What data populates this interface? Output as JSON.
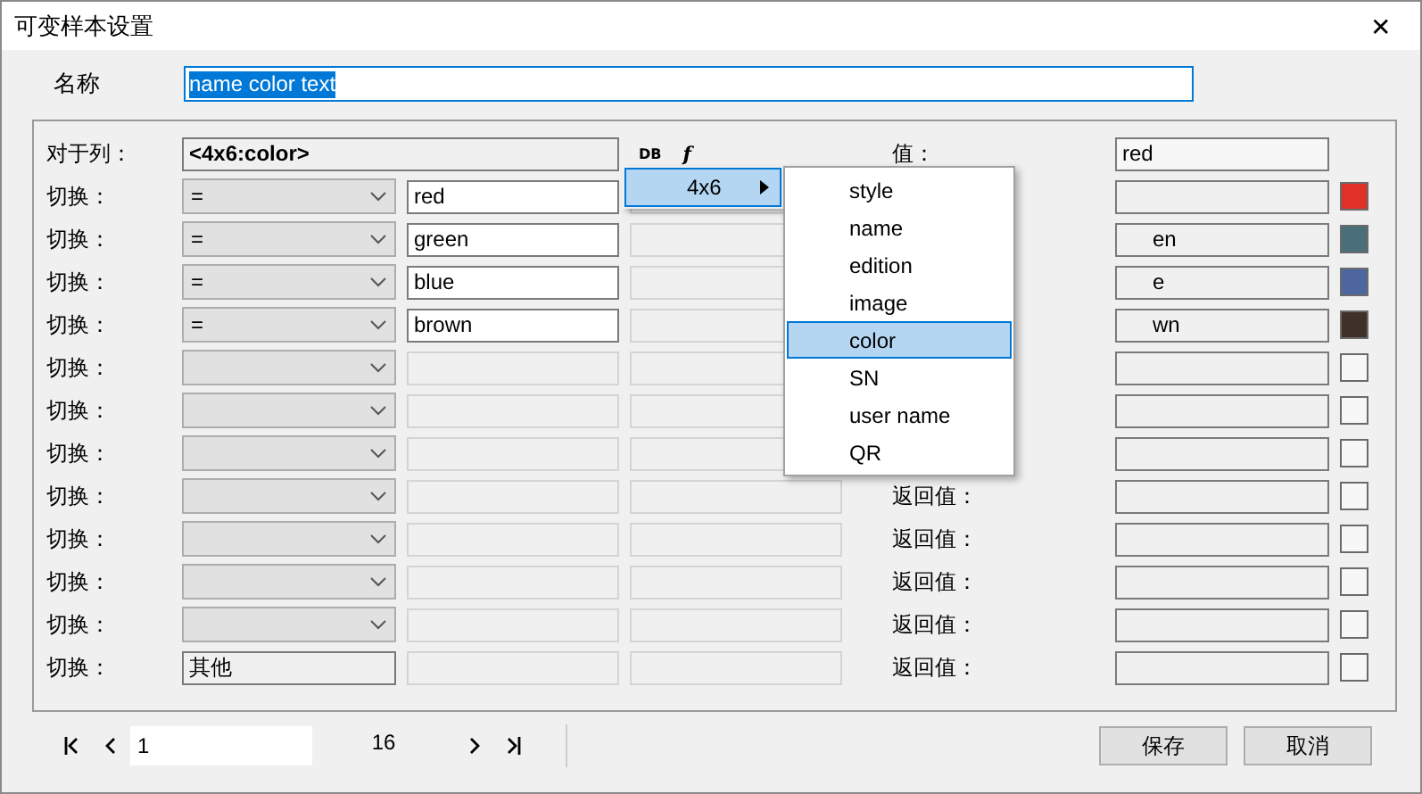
{
  "window": {
    "title": "可变样本设置",
    "close": "✕"
  },
  "name_field": {
    "label": "名称",
    "value": "name color text",
    "text_selected": true
  },
  "header": {
    "label": "对于列：",
    "column": "<4x6:color>",
    "db": "DB",
    "f": "f",
    "value_label": "值：",
    "value": "red"
  },
  "rows": [
    {
      "label": "切换：",
      "kind": "select",
      "operator": "=",
      "match": "red",
      "disabled": false,
      "value": "",
      "color": "#e03127"
    },
    {
      "label": "切换：",
      "kind": "select",
      "operator": "=",
      "match": "green",
      "disabled": false,
      "value": "en",
      "color": "#4a6e7a"
    },
    {
      "label": "切换：",
      "kind": "select",
      "operator": "=",
      "match": "blue",
      "disabled": false,
      "value": "e",
      "color": "#4d66a0"
    },
    {
      "label": "切换：",
      "kind": "select",
      "operator": "=",
      "match": "brown",
      "disabled": false,
      "value": "wn",
      "color": "#3d3129"
    },
    {
      "label": "切换：",
      "kind": "select",
      "disabled": true
    },
    {
      "label": "切换：",
      "kind": "select",
      "disabled": true
    },
    {
      "label": "切换：",
      "kind": "select",
      "disabled": true
    },
    {
      "label": "切换：",
      "kind": "select",
      "disabled": true,
      "return_label": "返回值："
    },
    {
      "label": "切换：",
      "kind": "select",
      "disabled": true,
      "return_label": "返回值："
    },
    {
      "label": "切换：",
      "kind": "select",
      "disabled": true,
      "return_label": "返回值："
    },
    {
      "label": "切换：",
      "kind": "select",
      "disabled": true,
      "return_label": "返回值："
    },
    {
      "label": "切换：",
      "kind": "text",
      "operator": "其他",
      "disabled": true,
      "return_label": "返回值："
    }
  ],
  "submenu": {
    "label": "4x6",
    "selected": true
  },
  "menu": [
    {
      "label": "style",
      "selected": false
    },
    {
      "label": "name",
      "selected": false
    },
    {
      "label": "edition",
      "selected": false
    },
    {
      "label": "image",
      "selected": false
    },
    {
      "label": "color",
      "selected": true
    },
    {
      "label": "SN",
      "selected": false
    },
    {
      "label": "user name",
      "selected": false
    },
    {
      "label": "QR",
      "selected": false
    }
  ],
  "pager": {
    "page": "1",
    "total": "16"
  },
  "buttons": [
    "保存",
    "取消"
  ]
}
